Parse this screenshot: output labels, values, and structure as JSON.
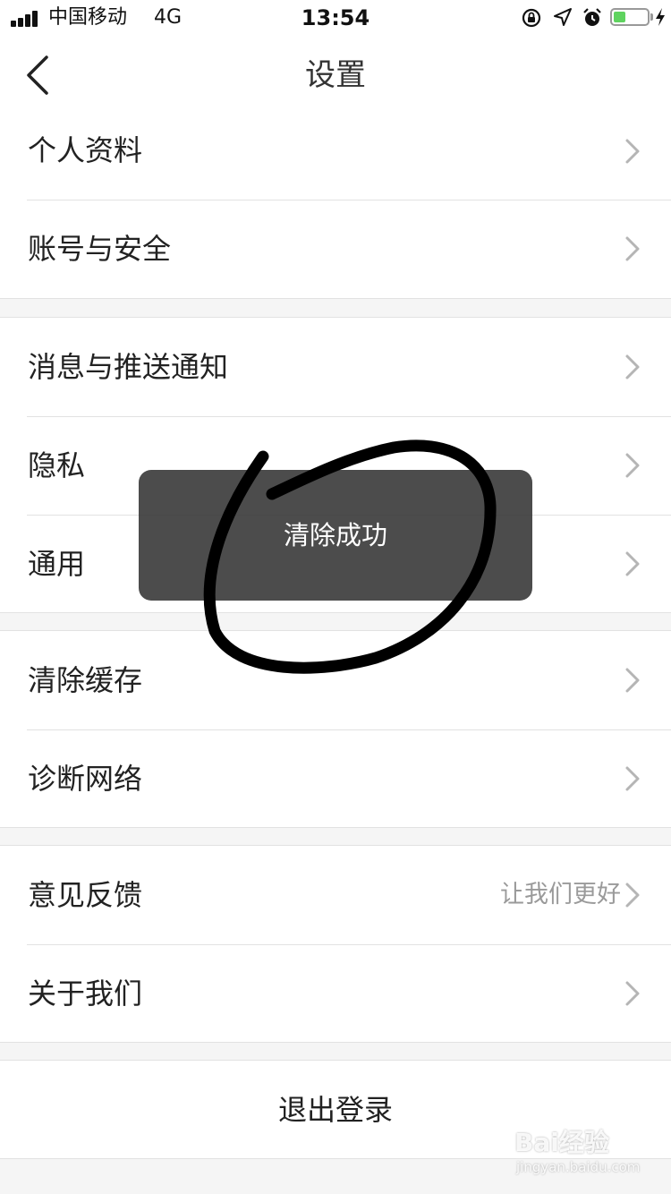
{
  "status_bar": {
    "carrier": "中国移动",
    "network": "4G",
    "time": "13:54",
    "icons": [
      "signal-bars-icon",
      "orientation-lock-icon",
      "location-arrow-icon",
      "alarm-clock-icon",
      "battery-icon",
      "charging-bolt-icon"
    ],
    "battery_level": 0.35,
    "battery_color": "#5fd35f"
  },
  "nav": {
    "title": "设置",
    "back_icon": "chevron-left-icon"
  },
  "groups": [
    {
      "items": [
        {
          "label": "个人资料"
        },
        {
          "label": "账号与安全"
        }
      ]
    },
    {
      "items": [
        {
          "label": "消息与推送通知"
        },
        {
          "label": "隐私"
        },
        {
          "label": "通用"
        }
      ]
    },
    {
      "items": [
        {
          "label": "清除缓存"
        },
        {
          "label": "诊断网络"
        }
      ]
    },
    {
      "items": [
        {
          "label": "意见反馈",
          "detail": "让我们更好"
        },
        {
          "label": "关于我们"
        }
      ]
    }
  ],
  "logout": {
    "label": "退出登录"
  },
  "toast": {
    "message": "清除成功"
  },
  "watermark": {
    "brand": "Bai经验",
    "url": "jingyan.baidu.com"
  },
  "colors": {
    "background": "#f5f5f5",
    "separator": "#e2e2e2",
    "chevron": "#b5b5b5",
    "toast_bg": "#383838"
  }
}
